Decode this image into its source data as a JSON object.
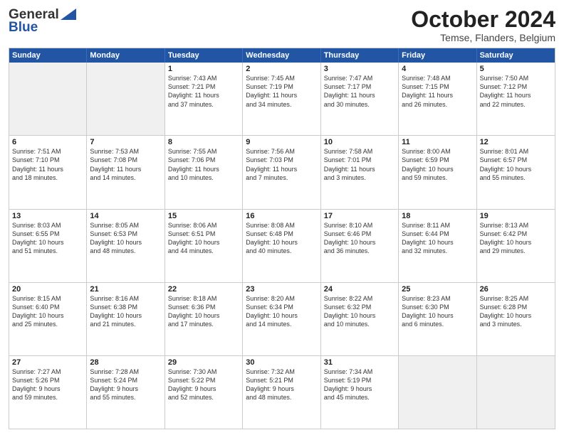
{
  "logo": {
    "line1": "General",
    "line2": "Blue"
  },
  "title": "October 2024",
  "subtitle": "Temse, Flanders, Belgium",
  "header_days": [
    "Sunday",
    "Monday",
    "Tuesday",
    "Wednesday",
    "Thursday",
    "Friday",
    "Saturday"
  ],
  "weeks": [
    [
      {
        "day": "",
        "lines": [],
        "shaded": true
      },
      {
        "day": "",
        "lines": [],
        "shaded": true
      },
      {
        "day": "1",
        "lines": [
          "Sunrise: 7:43 AM",
          "Sunset: 7:21 PM",
          "Daylight: 11 hours",
          "and 37 minutes."
        ]
      },
      {
        "day": "2",
        "lines": [
          "Sunrise: 7:45 AM",
          "Sunset: 7:19 PM",
          "Daylight: 11 hours",
          "and 34 minutes."
        ]
      },
      {
        "day": "3",
        "lines": [
          "Sunrise: 7:47 AM",
          "Sunset: 7:17 PM",
          "Daylight: 11 hours",
          "and 30 minutes."
        ]
      },
      {
        "day": "4",
        "lines": [
          "Sunrise: 7:48 AM",
          "Sunset: 7:15 PM",
          "Daylight: 11 hours",
          "and 26 minutes."
        ]
      },
      {
        "day": "5",
        "lines": [
          "Sunrise: 7:50 AM",
          "Sunset: 7:12 PM",
          "Daylight: 11 hours",
          "and 22 minutes."
        ]
      }
    ],
    [
      {
        "day": "6",
        "lines": [
          "Sunrise: 7:51 AM",
          "Sunset: 7:10 PM",
          "Daylight: 11 hours",
          "and 18 minutes."
        ]
      },
      {
        "day": "7",
        "lines": [
          "Sunrise: 7:53 AM",
          "Sunset: 7:08 PM",
          "Daylight: 11 hours",
          "and 14 minutes."
        ]
      },
      {
        "day": "8",
        "lines": [
          "Sunrise: 7:55 AM",
          "Sunset: 7:06 PM",
          "Daylight: 11 hours",
          "and 10 minutes."
        ]
      },
      {
        "day": "9",
        "lines": [
          "Sunrise: 7:56 AM",
          "Sunset: 7:03 PM",
          "Daylight: 11 hours",
          "and 7 minutes."
        ]
      },
      {
        "day": "10",
        "lines": [
          "Sunrise: 7:58 AM",
          "Sunset: 7:01 PM",
          "Daylight: 11 hours",
          "and 3 minutes."
        ]
      },
      {
        "day": "11",
        "lines": [
          "Sunrise: 8:00 AM",
          "Sunset: 6:59 PM",
          "Daylight: 10 hours",
          "and 59 minutes."
        ]
      },
      {
        "day": "12",
        "lines": [
          "Sunrise: 8:01 AM",
          "Sunset: 6:57 PM",
          "Daylight: 10 hours",
          "and 55 minutes."
        ]
      }
    ],
    [
      {
        "day": "13",
        "lines": [
          "Sunrise: 8:03 AM",
          "Sunset: 6:55 PM",
          "Daylight: 10 hours",
          "and 51 minutes."
        ]
      },
      {
        "day": "14",
        "lines": [
          "Sunrise: 8:05 AM",
          "Sunset: 6:53 PM",
          "Daylight: 10 hours",
          "and 48 minutes."
        ]
      },
      {
        "day": "15",
        "lines": [
          "Sunrise: 8:06 AM",
          "Sunset: 6:51 PM",
          "Daylight: 10 hours",
          "and 44 minutes."
        ]
      },
      {
        "day": "16",
        "lines": [
          "Sunrise: 8:08 AM",
          "Sunset: 6:48 PM",
          "Daylight: 10 hours",
          "and 40 minutes."
        ]
      },
      {
        "day": "17",
        "lines": [
          "Sunrise: 8:10 AM",
          "Sunset: 6:46 PM",
          "Daylight: 10 hours",
          "and 36 minutes."
        ]
      },
      {
        "day": "18",
        "lines": [
          "Sunrise: 8:11 AM",
          "Sunset: 6:44 PM",
          "Daylight: 10 hours",
          "and 32 minutes."
        ]
      },
      {
        "day": "19",
        "lines": [
          "Sunrise: 8:13 AM",
          "Sunset: 6:42 PM",
          "Daylight: 10 hours",
          "and 29 minutes."
        ]
      }
    ],
    [
      {
        "day": "20",
        "lines": [
          "Sunrise: 8:15 AM",
          "Sunset: 6:40 PM",
          "Daylight: 10 hours",
          "and 25 minutes."
        ]
      },
      {
        "day": "21",
        "lines": [
          "Sunrise: 8:16 AM",
          "Sunset: 6:38 PM",
          "Daylight: 10 hours",
          "and 21 minutes."
        ]
      },
      {
        "day": "22",
        "lines": [
          "Sunrise: 8:18 AM",
          "Sunset: 6:36 PM",
          "Daylight: 10 hours",
          "and 17 minutes."
        ]
      },
      {
        "day": "23",
        "lines": [
          "Sunrise: 8:20 AM",
          "Sunset: 6:34 PM",
          "Daylight: 10 hours",
          "and 14 minutes."
        ]
      },
      {
        "day": "24",
        "lines": [
          "Sunrise: 8:22 AM",
          "Sunset: 6:32 PM",
          "Daylight: 10 hours",
          "and 10 minutes."
        ]
      },
      {
        "day": "25",
        "lines": [
          "Sunrise: 8:23 AM",
          "Sunset: 6:30 PM",
          "Daylight: 10 hours",
          "and 6 minutes."
        ]
      },
      {
        "day": "26",
        "lines": [
          "Sunrise: 8:25 AM",
          "Sunset: 6:28 PM",
          "Daylight: 10 hours",
          "and 3 minutes."
        ]
      }
    ],
    [
      {
        "day": "27",
        "lines": [
          "Sunrise: 7:27 AM",
          "Sunset: 5:26 PM",
          "Daylight: 9 hours",
          "and 59 minutes."
        ]
      },
      {
        "day": "28",
        "lines": [
          "Sunrise: 7:28 AM",
          "Sunset: 5:24 PM",
          "Daylight: 9 hours",
          "and 55 minutes."
        ]
      },
      {
        "day": "29",
        "lines": [
          "Sunrise: 7:30 AM",
          "Sunset: 5:22 PM",
          "Daylight: 9 hours",
          "and 52 minutes."
        ]
      },
      {
        "day": "30",
        "lines": [
          "Sunrise: 7:32 AM",
          "Sunset: 5:21 PM",
          "Daylight: 9 hours",
          "and 48 minutes."
        ]
      },
      {
        "day": "31",
        "lines": [
          "Sunrise: 7:34 AM",
          "Sunset: 5:19 PM",
          "Daylight: 9 hours",
          "and 45 minutes."
        ]
      },
      {
        "day": "",
        "lines": [],
        "shaded": true
      },
      {
        "day": "",
        "lines": [],
        "shaded": true
      }
    ]
  ]
}
